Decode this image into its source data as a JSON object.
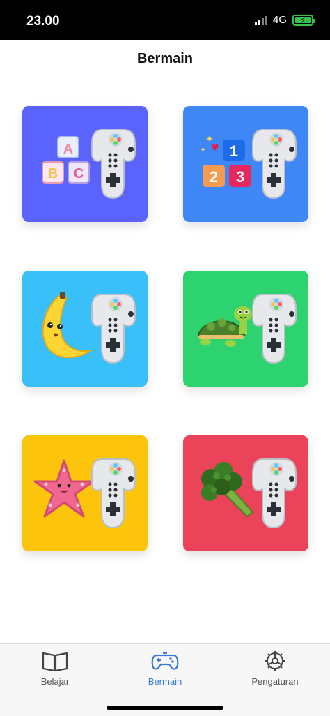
{
  "status": {
    "time": "23.00",
    "network": "4G",
    "battery_color": "#36c24a"
  },
  "header": {
    "title": "Bermain"
  },
  "cards": [
    {
      "name": "alphabet",
      "color": "#5b63ff",
      "letters": [
        "A",
        "B",
        "C"
      ]
    },
    {
      "name": "numbers",
      "color": "#3f86f6",
      "digits": [
        "1",
        "2",
        "3"
      ]
    },
    {
      "name": "fruits",
      "color": "#39c0f8"
    },
    {
      "name": "animals",
      "color": "#2dd36f"
    },
    {
      "name": "sea-animals",
      "color": "#fdc40c"
    },
    {
      "name": "vegetables",
      "color": "#eb445a"
    }
  ],
  "tabs": [
    {
      "label": "Belajar",
      "icon": "book-icon",
      "active": false
    },
    {
      "label": "Bermain",
      "icon": "gamepad-icon",
      "active": true
    },
    {
      "label": "Pengaturan",
      "icon": "gear-icon",
      "active": false
    }
  ],
  "accent": "#3a7bd5"
}
